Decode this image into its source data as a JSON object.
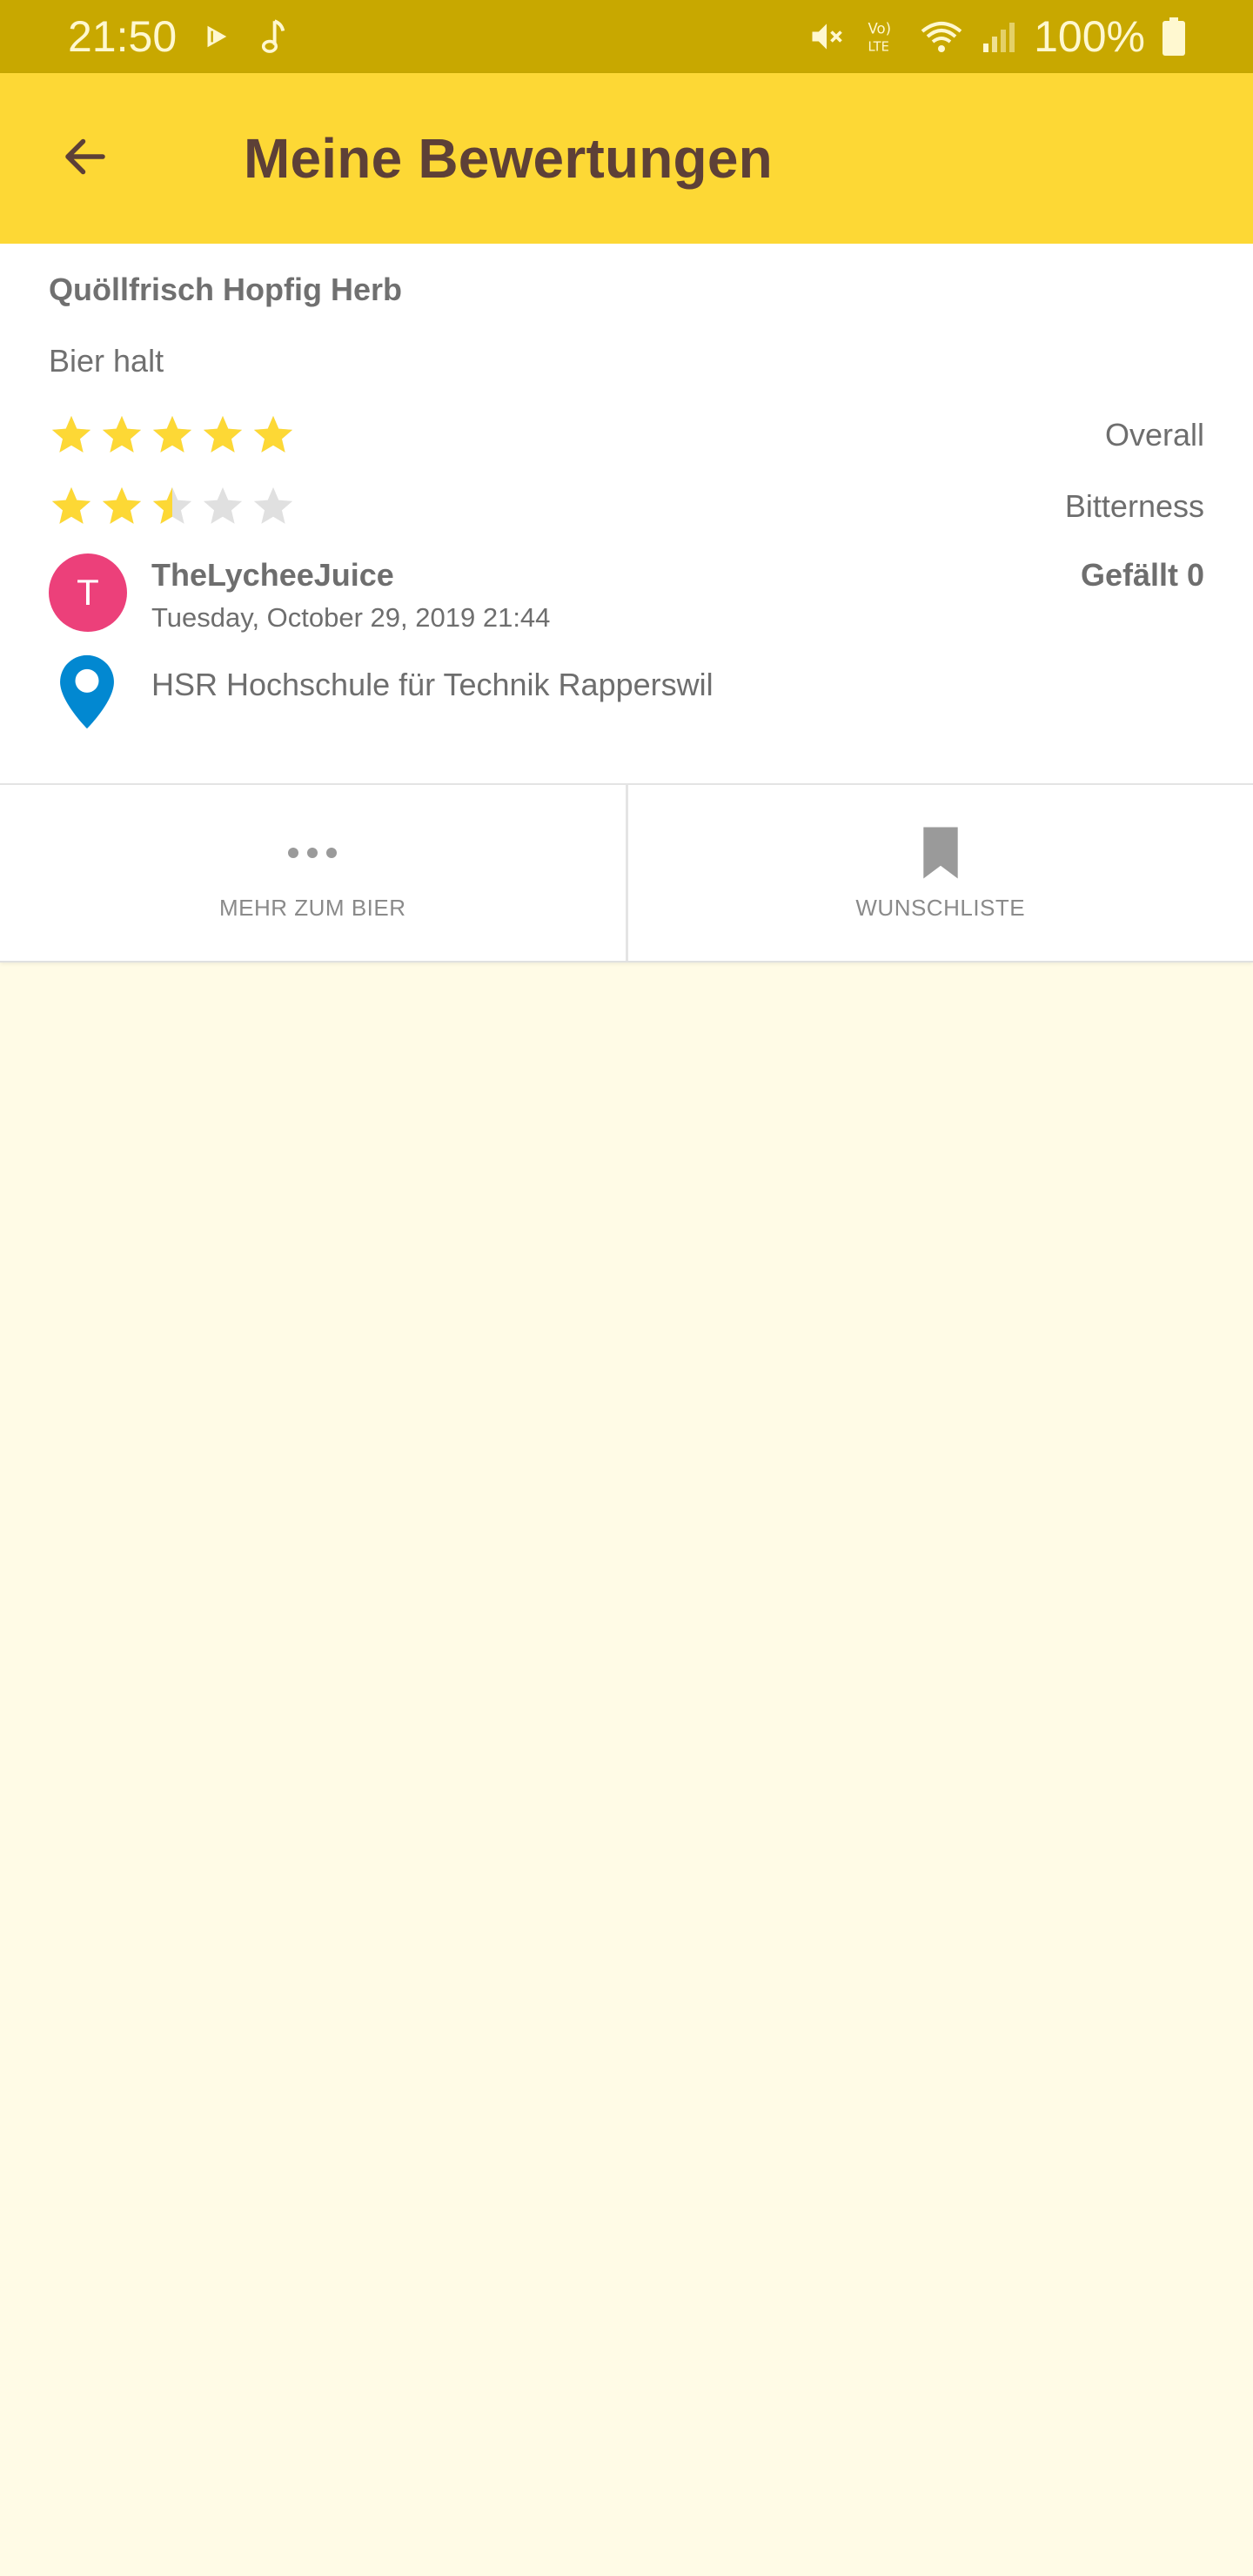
{
  "status_bar": {
    "time": "21:50",
    "battery": "100%",
    "icons": [
      "play-store-icon",
      "music-note-icon",
      "mute-icon",
      "volte-icon",
      "wifi-icon",
      "signal-icon",
      "battery-icon"
    ]
  },
  "app_bar": {
    "title": "Meine Bewertungen",
    "back_icon": "arrow-left-icon"
  },
  "review": {
    "beer_name": "Quöllfrisch Hopfig Herb",
    "comment": "Bier halt",
    "ratings": [
      {
        "label": "Overall",
        "value": 5,
        "max": 5
      },
      {
        "label": "Bitterness",
        "value": 2.5,
        "max": 5
      }
    ],
    "author": {
      "initial": "T",
      "name": "TheLycheeJuice",
      "timestamp": "Tuesday, October 29, 2019 21:44",
      "avatar_color": "#ec407a"
    },
    "likes": "Gefällt 0",
    "location": "HSR Hochschule für Technik Rapperswil"
  },
  "actions": [
    {
      "label": "MEHR ZUM BIER",
      "icon": "more-dots-icon"
    },
    {
      "label": "WUNSCHLISTE",
      "icon": "bookmark-icon"
    }
  ],
  "colors": {
    "status_bar": "#c8a800",
    "app_bar": "#fdd835",
    "title": "#5d4037",
    "star_filled": "#fdd835",
    "star_empty": "#e0e0e0",
    "pin": "#0288d1",
    "background": "#fffbe6"
  }
}
